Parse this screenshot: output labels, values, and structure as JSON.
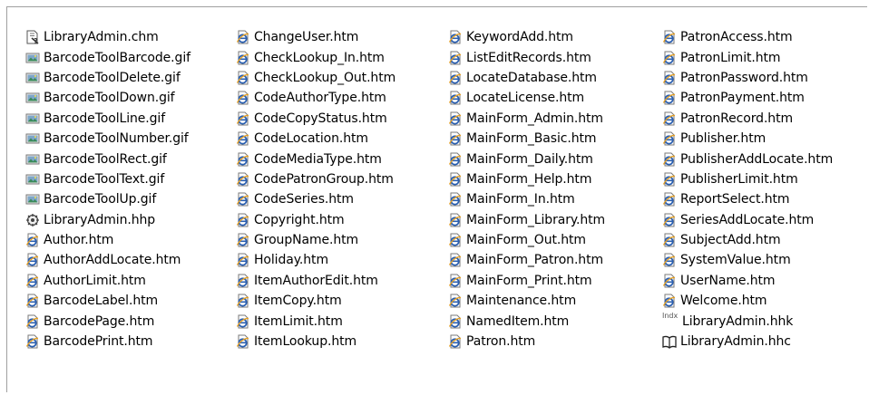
{
  "files": [
    [
      {
        "name": "LibraryAdmin.chm",
        "icon": "chm-help-icon"
      },
      {
        "name": "BarcodeToolBarcode.gif",
        "icon": "gif-image-icon"
      },
      {
        "name": "BarcodeToolDelete.gif",
        "icon": "gif-image-icon"
      },
      {
        "name": "BarcodeToolDown.gif",
        "icon": "gif-image-icon"
      },
      {
        "name": "BarcodeToolLine.gif",
        "icon": "gif-image-icon"
      },
      {
        "name": "BarcodeToolNumber.gif",
        "icon": "gif-image-icon"
      },
      {
        "name": "BarcodeToolRect.gif",
        "icon": "gif-image-icon"
      },
      {
        "name": "BarcodeToolText.gif",
        "icon": "gif-image-icon"
      },
      {
        "name": "BarcodeToolUp.gif",
        "icon": "gif-image-icon"
      },
      {
        "name": "LibraryAdmin.hhp",
        "icon": "hhp-project-icon"
      },
      {
        "name": "Author.htm",
        "icon": "ie-document-icon"
      },
      {
        "name": "AuthorAddLocate.htm",
        "icon": "ie-document-icon"
      },
      {
        "name": "AuthorLimit.htm",
        "icon": "ie-document-icon"
      },
      {
        "name": "BarcodeLabel.htm",
        "icon": "ie-document-icon"
      },
      {
        "name": "BarcodePage.htm",
        "icon": "ie-document-icon"
      },
      {
        "name": "BarcodePrint.htm",
        "icon": "ie-document-icon"
      }
    ],
    [
      {
        "name": "ChangeUser.htm",
        "icon": "ie-document-icon"
      },
      {
        "name": "CheckLookup_In.htm",
        "icon": "ie-document-icon"
      },
      {
        "name": "CheckLookup_Out.htm",
        "icon": "ie-document-icon"
      },
      {
        "name": "CodeAuthorType.htm",
        "icon": "ie-document-icon"
      },
      {
        "name": "CodeCopyStatus.htm",
        "icon": "ie-document-icon"
      },
      {
        "name": "CodeLocation.htm",
        "icon": "ie-document-icon"
      },
      {
        "name": "CodeMediaType.htm",
        "icon": "ie-document-icon"
      },
      {
        "name": "CodePatronGroup.htm",
        "icon": "ie-document-icon"
      },
      {
        "name": "CodeSeries.htm",
        "icon": "ie-document-icon"
      },
      {
        "name": "Copyright.htm",
        "icon": "ie-document-icon"
      },
      {
        "name": "GroupName.htm",
        "icon": "ie-document-icon"
      },
      {
        "name": "Holiday.htm",
        "icon": "ie-document-icon"
      },
      {
        "name": "ItemAuthorEdit.htm",
        "icon": "ie-document-icon"
      },
      {
        "name": "ItemCopy.htm",
        "icon": "ie-document-icon"
      },
      {
        "name": "ItemLimit.htm",
        "icon": "ie-document-icon"
      },
      {
        "name": "ItemLookup.htm",
        "icon": "ie-document-icon"
      }
    ],
    [
      {
        "name": "KeywordAdd.htm",
        "icon": "ie-document-icon"
      },
      {
        "name": "ListEditRecords.htm",
        "icon": "ie-document-icon"
      },
      {
        "name": "LocateDatabase.htm",
        "icon": "ie-document-icon"
      },
      {
        "name": "LocateLicense.htm",
        "icon": "ie-document-icon"
      },
      {
        "name": "MainForm_Admin.htm",
        "icon": "ie-document-icon"
      },
      {
        "name": "MainForm_Basic.htm",
        "icon": "ie-document-icon"
      },
      {
        "name": "MainForm_Daily.htm",
        "icon": "ie-document-icon"
      },
      {
        "name": "MainForm_Help.htm",
        "icon": "ie-document-icon"
      },
      {
        "name": "MainForm_In.htm",
        "icon": "ie-document-icon"
      },
      {
        "name": "MainForm_Library.htm",
        "icon": "ie-document-icon"
      },
      {
        "name": "MainForm_Out.htm",
        "icon": "ie-document-icon"
      },
      {
        "name": "MainForm_Patron.htm",
        "icon": "ie-document-icon"
      },
      {
        "name": "MainForm_Print.htm",
        "icon": "ie-document-icon"
      },
      {
        "name": "Maintenance.htm",
        "icon": "ie-document-icon"
      },
      {
        "name": "NamedItem.htm",
        "icon": "ie-document-icon"
      },
      {
        "name": "Patron.htm",
        "icon": "ie-document-icon"
      }
    ],
    [
      {
        "name": "PatronAccess.htm",
        "icon": "ie-document-icon"
      },
      {
        "name": "PatronLimit.htm",
        "icon": "ie-document-icon"
      },
      {
        "name": "PatronPassword.htm",
        "icon": "ie-document-icon"
      },
      {
        "name": "PatronPayment.htm",
        "icon": "ie-document-icon"
      },
      {
        "name": "PatronRecord.htm",
        "icon": "ie-document-icon"
      },
      {
        "name": "Publisher.htm",
        "icon": "ie-document-icon"
      },
      {
        "name": "PublisherAddLocate.htm",
        "icon": "ie-document-icon"
      },
      {
        "name": "PublisherLimit.htm",
        "icon": "ie-document-icon"
      },
      {
        "name": "ReportSelect.htm",
        "icon": "ie-document-icon"
      },
      {
        "name": "SeriesAddLocate.htm",
        "icon": "ie-document-icon"
      },
      {
        "name": "SubjectAdd.htm",
        "icon": "ie-document-icon"
      },
      {
        "name": "SystemValue.htm",
        "icon": "ie-document-icon"
      },
      {
        "name": "UserName.htm",
        "icon": "ie-document-icon"
      },
      {
        "name": "Welcome.htm",
        "icon": "ie-document-icon"
      },
      {
        "name": "LibraryAdmin.hhk",
        "icon": "hhk-index-icon",
        "icon_text": "Indx"
      },
      {
        "name": "LibraryAdmin.hhc",
        "icon": "hhc-contents-icon"
      }
    ]
  ],
  "colors": {
    "ie_blue": "#2a5fb0",
    "ie_orange": "#e8a020",
    "gif_green": "#3a8a5a",
    "border": "#a0a0a0"
  }
}
